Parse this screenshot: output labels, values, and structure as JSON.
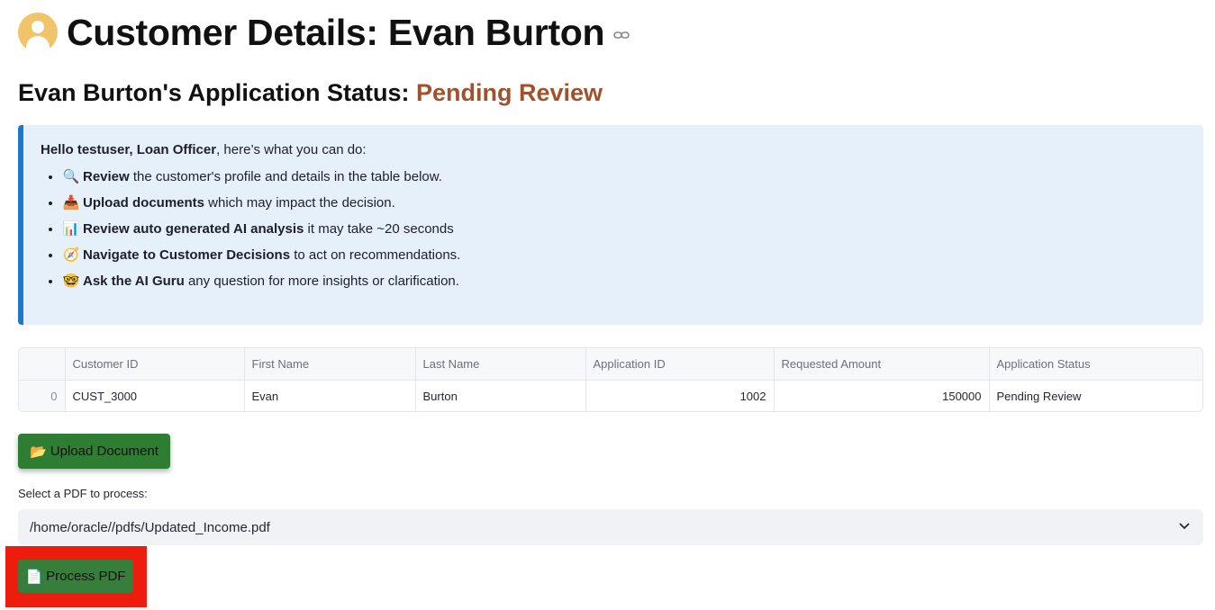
{
  "header": {
    "title": "Customer Details: Evan Burton",
    "avatar_icon": "user-avatar-icon",
    "link_icon": "link-icon"
  },
  "subheader": {
    "prefix": "Evan Burton's Application Status:",
    "status": "Pending Review",
    "status_color": "#a0522d"
  },
  "info": {
    "greet_bold": "Hello testuser, Loan Officer",
    "greet_rest": ", here’s what you can do:",
    "items": [
      {
        "icon": "🔍",
        "icon_name": "magnifier-icon",
        "bold": "Review",
        "rest": " the customer's profile and details in the table below."
      },
      {
        "icon": "📥",
        "icon_name": "inbox-tray-icon",
        "bold": "Upload documents",
        "rest": " which may impact the decision."
      },
      {
        "icon": "📊",
        "icon_name": "bar-chart-icon",
        "bold": "Review auto generated AI analysis",
        "rest": " it may take ~20 seconds"
      },
      {
        "icon": "🧭",
        "icon_name": "compass-icon",
        "bold": "Navigate to Customer Decisions",
        "rest": " to act on recommendations."
      },
      {
        "icon": "🤓",
        "icon_name": "nerd-face-icon",
        "bold": "Ask the AI Guru",
        "rest": " any question for more insights or clarification."
      }
    ],
    "accent_color": "#1f77c9"
  },
  "table": {
    "headers": [
      "",
      "Customer ID",
      "First Name",
      "Last Name",
      "Application ID",
      "Requested Amount",
      "Application Status"
    ],
    "rows": [
      [
        "0",
        "CUST_3000",
        "Evan",
        "Burton",
        "1002",
        "150000",
        "Pending Review"
      ]
    ]
  },
  "upload": {
    "icon": "📂",
    "icon_name": "folder-icon",
    "label": "Upload Document"
  },
  "pdf_select": {
    "label": "Select a PDF to process:",
    "value": "/home/oracle//pdfs/Updated_Income.pdf",
    "chevron_icon": "chevron-down-icon"
  },
  "process": {
    "icon": "📄",
    "icon_name": "document-icon",
    "label": "Process PDF"
  },
  "colors": {
    "button_green": "#2f7d32",
    "highlight_red": "#ee1c0d"
  }
}
